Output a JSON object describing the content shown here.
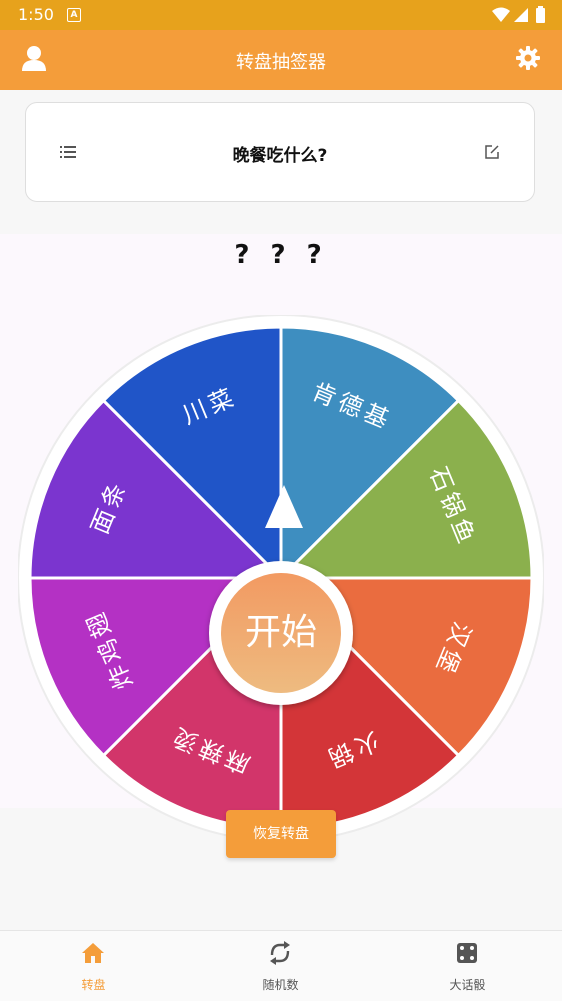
{
  "status": {
    "time": "1:50",
    "a_icon": "A"
  },
  "header": {
    "title": "转盘抽签器",
    "left_icon": "user-icon",
    "right_icon": "gear-icon"
  },
  "question_card": {
    "title": "晚餐吃什么?",
    "left_icon": "list-icon",
    "right_icon": "edit-icon"
  },
  "result_text": "? ? ?",
  "wheel": {
    "start_label": "开始",
    "segments": [
      {
        "label": "肯德基",
        "color": "#3e8ec0"
      },
      {
        "label": "石锅鱼",
        "color": "#8bb04d"
      },
      {
        "label": "汉堡",
        "color": "#ea6c3f"
      },
      {
        "label": "火锅",
        "color": "#d33538"
      },
      {
        "label": "麻辣烫",
        "color": "#d2356a"
      },
      {
        "label": "炸鸡翅",
        "color": "#b431c4"
      },
      {
        "label": "面条",
        "color": "#7b35cf"
      },
      {
        "label": "川菜",
        "color": "#2055c8"
      }
    ]
  },
  "restore_button": "恢复转盘",
  "bottom_nav": [
    {
      "label": "转盘",
      "icon": "home-icon",
      "active": true
    },
    {
      "label": "随机数",
      "icon": "shuffle-icon",
      "active": false
    },
    {
      "label": "大话骰",
      "icon": "dice-icon",
      "active": false
    }
  ],
  "colors": {
    "accent": "#f49d3a",
    "status_bar": "#e7a21c",
    "inactive": "#555555"
  }
}
